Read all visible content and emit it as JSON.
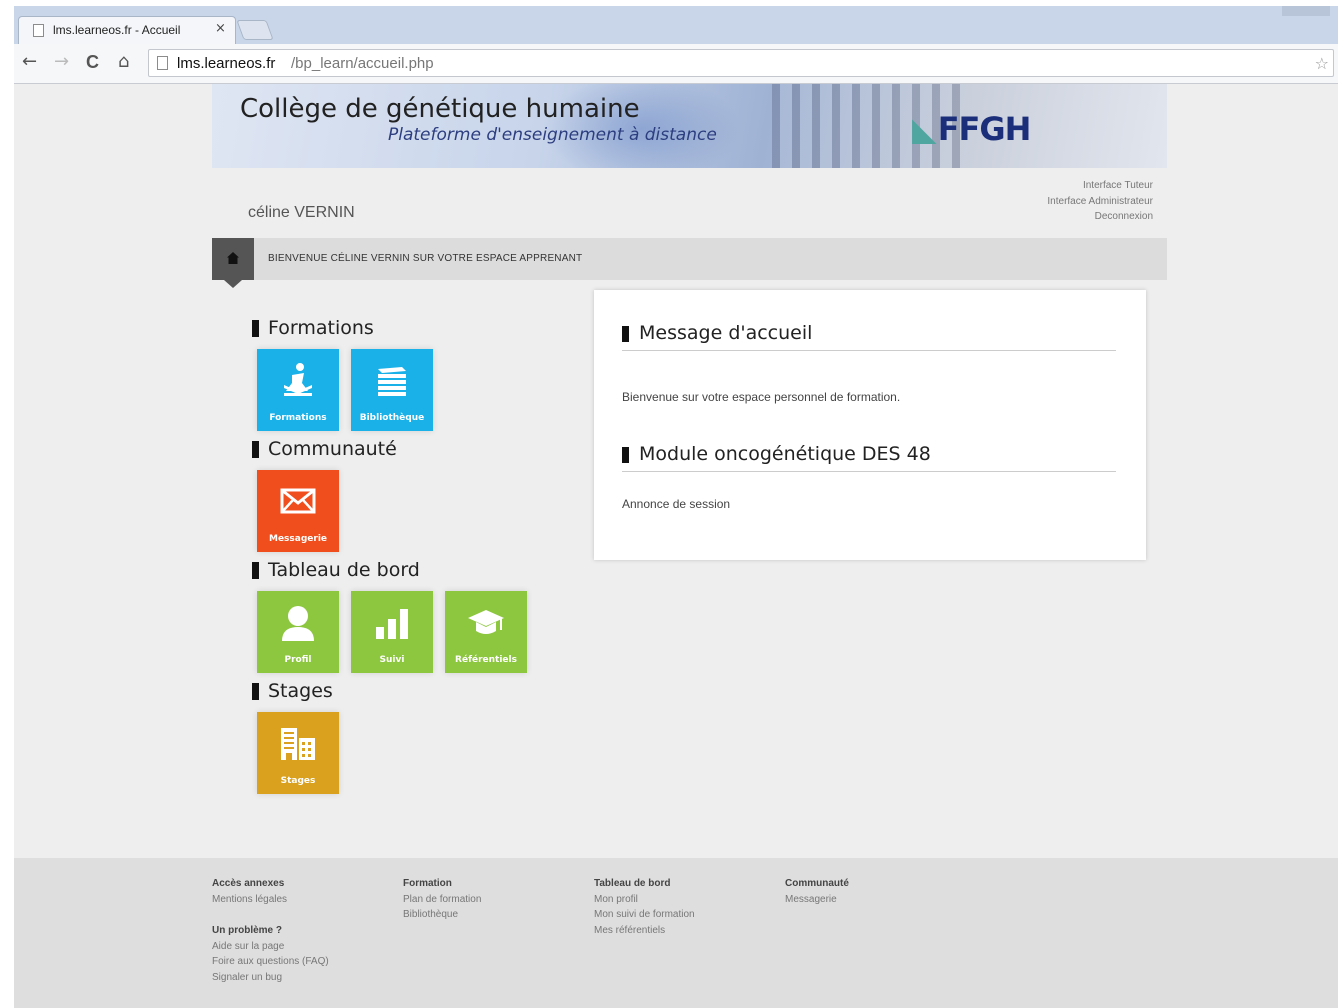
{
  "browser": {
    "tab_title": "lms.learneos.fr - Accueil",
    "tab_close": "×",
    "url_host": "lms.learneos.fr",
    "url_path": "/bp_learn/accueil.php",
    "back": "←",
    "forward": "→",
    "reload": "C",
    "home": "⌂",
    "star": "☆"
  },
  "header": {
    "title": "Collège de génétique humaine",
    "subtitle": "Plateforme d'enseignement à distance",
    "logo_mark": "◣",
    "logo_text": "FFGH"
  },
  "user": {
    "name": "céline VERNIN"
  },
  "top_links": [
    "Interface Tuteur",
    "Interface Administrateur",
    "Deconnexion"
  ],
  "welcome": "BIENVENUE CÉLINE VERNIN SUR VOTRE ESPACE APPRENANT",
  "sections": {
    "formations": {
      "title": "Formations",
      "tiles": [
        {
          "label": "Formations",
          "icon": "reading-person-icon"
        },
        {
          "label": "Bibliothèque",
          "icon": "stacked-books-icon"
        }
      ]
    },
    "communaute": {
      "title": "Communauté",
      "tiles": [
        {
          "label": "Messagerie",
          "icon": "envelope-icon"
        }
      ]
    },
    "tableau": {
      "title": "Tableau de bord",
      "tiles": [
        {
          "label": "Profil",
          "icon": "user-icon"
        },
        {
          "label": "Suivi",
          "icon": "bar-chart-icon"
        },
        {
          "label": "Référentiels",
          "icon": "graduation-cap-icon"
        }
      ]
    },
    "stages": {
      "title": "Stages",
      "tiles": [
        {
          "label": "Stages",
          "icon": "building-icon"
        }
      ]
    }
  },
  "panel": {
    "h1": "Message d'accueil",
    "p1": "Bienvenue sur votre espace personnel de formation.",
    "h2": "Module oncogénétique DES 48",
    "p2": "Annonce de session"
  },
  "footer": {
    "col1": {
      "title": "Accès annexes",
      "links": [
        "Mentions légales"
      ],
      "title2": "Un problème ?",
      "links2": [
        "Aide sur la page",
        "Foire aux questions (FAQ)",
        "Signaler un bug"
      ]
    },
    "col2": {
      "title": "Formation",
      "links": [
        "Plan de formation",
        "Bibliothèque"
      ]
    },
    "col3": {
      "title": "Tableau de bord",
      "links": [
        "Mon profil",
        "Mon suivi de formation",
        "Mes référentiels"
      ]
    },
    "col4": {
      "title": "Communauté",
      "links": [
        "Messagerie"
      ]
    }
  },
  "colors": {
    "blue": "#1ab0e8",
    "red": "#f04e1c",
    "green": "#8dc63f",
    "gold": "#d9a11e"
  }
}
